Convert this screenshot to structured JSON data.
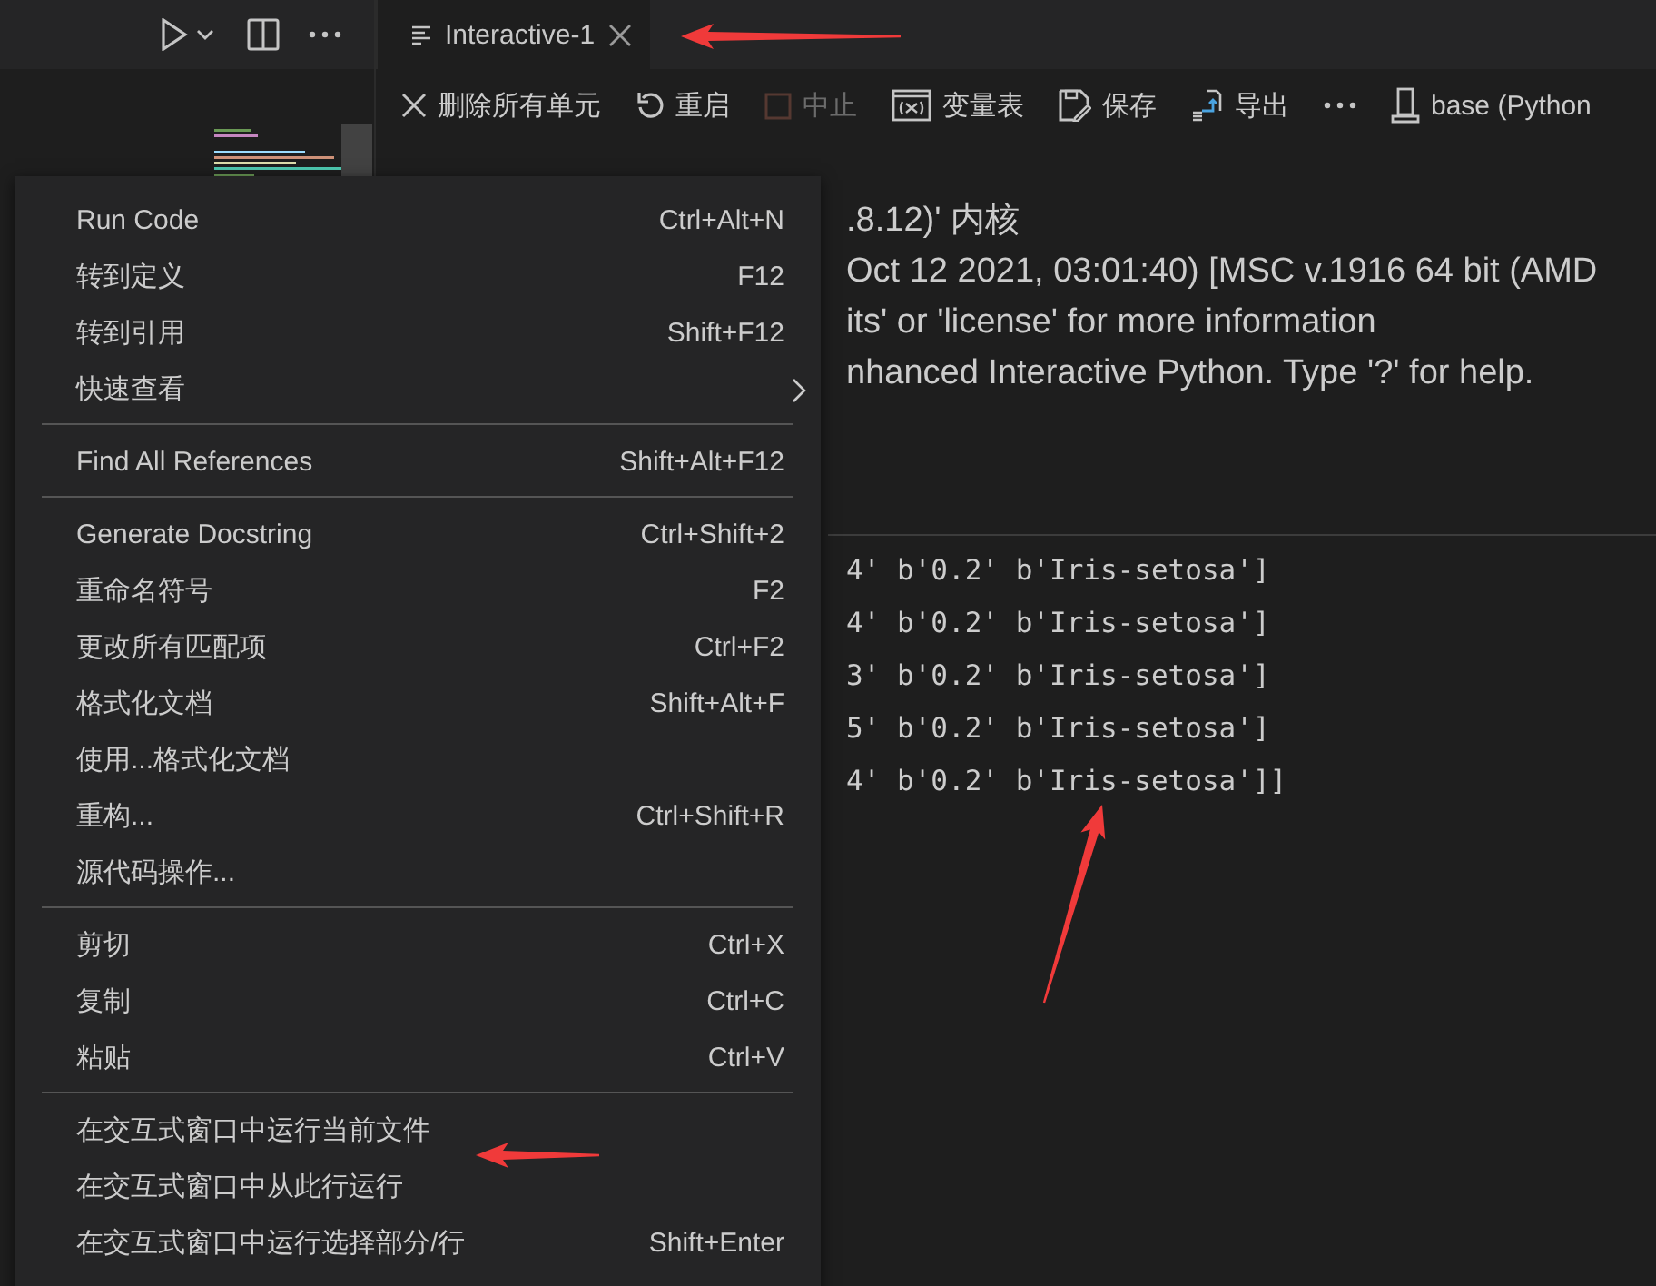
{
  "editor_toolbar": {
    "buttons": [
      {
        "kind": "run"
      },
      {
        "kind": "chevron"
      },
      {
        "kind": "split"
      },
      {
        "kind": "more"
      }
    ]
  },
  "tabs": [
    {
      "label": "Interactive-1",
      "selected": true
    }
  ],
  "toolbar": [
    {
      "kind": "clear",
      "label": "删除所有单元",
      "disabled": false
    },
    {
      "kind": "restart",
      "label": "重启",
      "disabled": false
    },
    {
      "kind": "interrupt",
      "label": "中止",
      "disabled": true
    },
    {
      "kind": "variables",
      "label": "变量表",
      "disabled": false
    },
    {
      "kind": "save",
      "label": "保存",
      "disabled": false
    },
    {
      "kind": "export",
      "label": "导出",
      "disabled": false
    },
    {
      "kind": "more",
      "disabled": false
    },
    {
      "kind": "kernel",
      "label": "base (Python",
      "disabled": false
    }
  ],
  "kernel_info": [
    ".8.12)' 内核",
    "Oct 12 2021, 03:01:40) [MSC v.1916 64 bit (AMD",
    "its' or 'license' for more information",
    "nhanced Interactive Python. Type '?' for help."
  ],
  "output_lines": [
    "4' b'0.2' b'Iris-setosa']",
    "4' b'0.2' b'Iris-setosa']",
    "3' b'0.2' b'Iris-setosa']",
    "5' b'0.2' b'Iris-setosa']",
    "4' b'0.2' b'Iris-setosa']]"
  ],
  "context_menu": {
    "groups": [
      [
        {
          "label": "Run Code",
          "shortcut": "Ctrl+Alt+N",
          "kind": "command"
        },
        {
          "label": "转到定义",
          "shortcut": "F12",
          "kind": "command"
        },
        {
          "label": "转到引用",
          "shortcut": "Shift+F12",
          "kind": "command"
        },
        {
          "label": "快速查看",
          "kind": "submenu"
        }
      ],
      [
        {
          "label": "Find All References",
          "shortcut": "Shift+Alt+F12",
          "kind": "command"
        }
      ],
      [
        {
          "label": "Generate Docstring",
          "shortcut": "Ctrl+Shift+2",
          "kind": "command"
        },
        {
          "label": "重命名符号",
          "shortcut": "F2",
          "kind": "command"
        },
        {
          "label": "更改所有匹配项",
          "shortcut": "Ctrl+F2",
          "kind": "command"
        },
        {
          "label": "格式化文档",
          "shortcut": "Shift+Alt+F",
          "kind": "command"
        },
        {
          "label": "使用...格式化文档",
          "kind": "command"
        },
        {
          "label": "重构...",
          "shortcut": "Ctrl+Shift+R",
          "kind": "command"
        },
        {
          "label": "源代码操作...",
          "kind": "command"
        }
      ],
      [
        {
          "label": "剪切",
          "shortcut": "Ctrl+X",
          "kind": "command"
        },
        {
          "label": "复制",
          "shortcut": "Ctrl+C",
          "kind": "command"
        },
        {
          "label": "粘贴",
          "shortcut": "Ctrl+V",
          "kind": "command"
        }
      ],
      [
        {
          "label": "在交互式窗口中运行当前文件",
          "kind": "command"
        },
        {
          "label": "在交互式窗口中从此行运行",
          "kind": "command"
        },
        {
          "label": "在交互式窗口中运行选择部分/行",
          "shortcut": "Shift+Enter",
          "kind": "command"
        }
      ]
    ]
  }
}
